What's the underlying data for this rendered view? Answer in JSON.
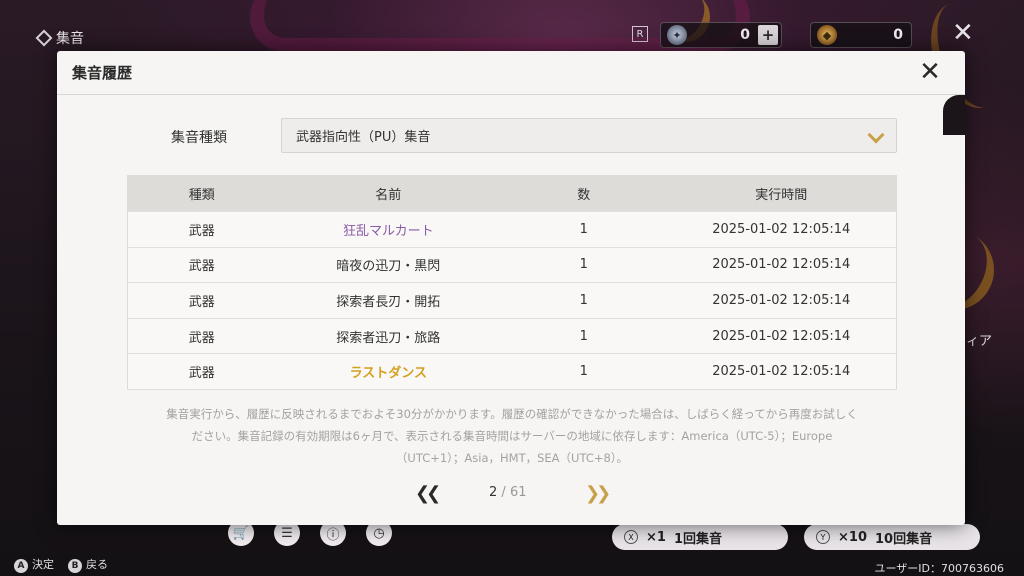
{
  "background": {
    "title": "集音",
    "currency1_value": "0",
    "currency2_value": "0",
    "side_text": "ィア",
    "user_id": "ユーザーID：700763606",
    "bottom_hints": [
      {
        "glyph": "A",
        "label": "決定"
      },
      {
        "glyph": "B",
        "label": "戻る"
      }
    ],
    "pull_single": {
      "glyph": "X",
      "count": "×1",
      "label": "1回集音"
    },
    "pull_ten": {
      "glyph": "Y",
      "count": "×10",
      "label": "10回集音"
    }
  },
  "modal": {
    "title": "集音履歴",
    "filter_label": "集音種類",
    "filter_value": "武器指向性（PU）集音",
    "columns": [
      "種類",
      "名前",
      "数",
      "実行時間"
    ],
    "rows": [
      {
        "type": "武器",
        "name": "狂乱マルカート",
        "count": "1",
        "time": "2025-01-02 12:05:14",
        "rarity": "purple"
      },
      {
        "type": "武器",
        "name": "暗夜の迅刀・黒閃",
        "count": "1",
        "time": "2025-01-02 12:05:14",
        "rarity": "normal"
      },
      {
        "type": "武器",
        "name": "探索者長刃・開拓",
        "count": "1",
        "time": "2025-01-02 12:05:14",
        "rarity": "normal"
      },
      {
        "type": "武器",
        "name": "探索者迅刀・旅路",
        "count": "1",
        "time": "2025-01-02 12:05:14",
        "rarity": "normal"
      },
      {
        "type": "武器",
        "name": "ラストダンス",
        "count": "1",
        "time": "2025-01-02 12:05:14",
        "rarity": "gold"
      }
    ],
    "note_line1": "集音実行から、履歴に反映されるまでおよそ30分がかかります。履歴の確認ができなかった場合は、しばらく経ってから再度お試しく",
    "note_line2": "ださい。集音記録の有効期限は6ヶ月で、表示される集音時間はサーバーの地域に依存します：America（UTC-5）；Europe",
    "note_line3": "（UTC+1）；Asia，HMT，SEA（UTC+8）。",
    "pager": {
      "current": "2",
      "separator": "/",
      "total": "61"
    }
  },
  "colors": {
    "accent_gold": "#c9a04a",
    "rarity_purple": "#8a5aa8",
    "rarity_gold": "#d4a020"
  }
}
